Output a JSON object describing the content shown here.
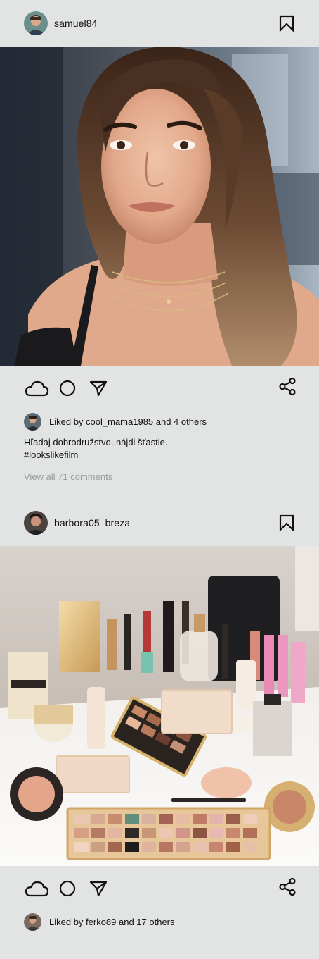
{
  "posts": [
    {
      "username": "samuel84",
      "likes_text": "Liked by cool_mama1985 and 4 others",
      "caption": "Hľadaj dobrodružstvo, nájdi šťastie.",
      "hashtag": "#lookslikefilm",
      "comments_link": "View all 71 comments"
    },
    {
      "username": "barbora05_breza",
      "likes_text": "Liked by ferko89 and 17 others"
    }
  ],
  "icons": {
    "bookmark": "bookmark-icon",
    "like": "cloud-icon",
    "comment": "circle-icon",
    "send": "send-arrow-icon",
    "share": "share-icon"
  },
  "colors": {
    "background": "#e2e4e3",
    "muted_text": "#9a9c9b"
  }
}
